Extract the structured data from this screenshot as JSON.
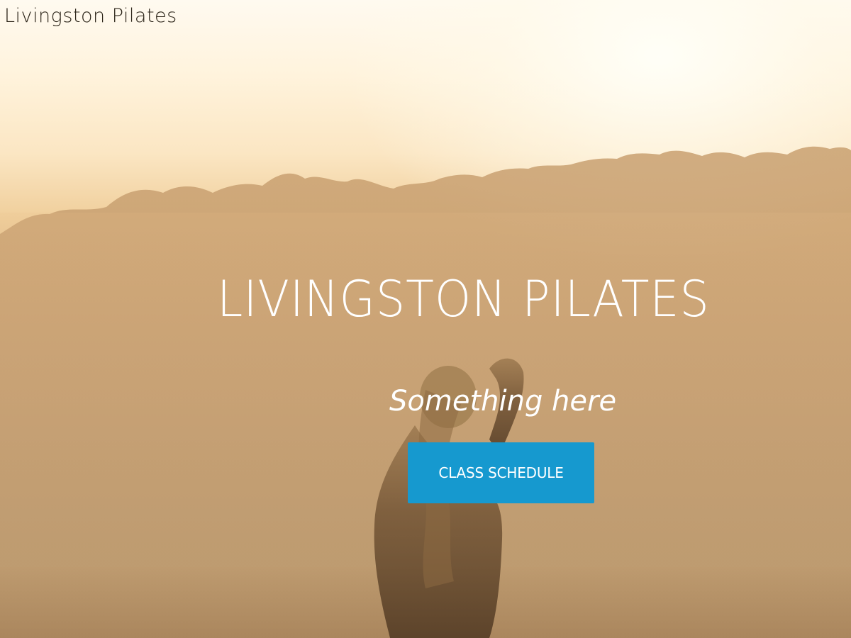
{
  "site": {
    "brand_name": "Livingston Pilates"
  },
  "hero": {
    "title": "LIVINGSTON PILATES",
    "tagline": "Something here",
    "cta_label": "CLASS SCHEDULE",
    "background_image": "misty sunrise treeline with woman stretching"
  },
  "colors": {
    "cta_background": "#1699cf",
    "hero_text": "#ffffff",
    "brand_text": "#2b2418"
  }
}
